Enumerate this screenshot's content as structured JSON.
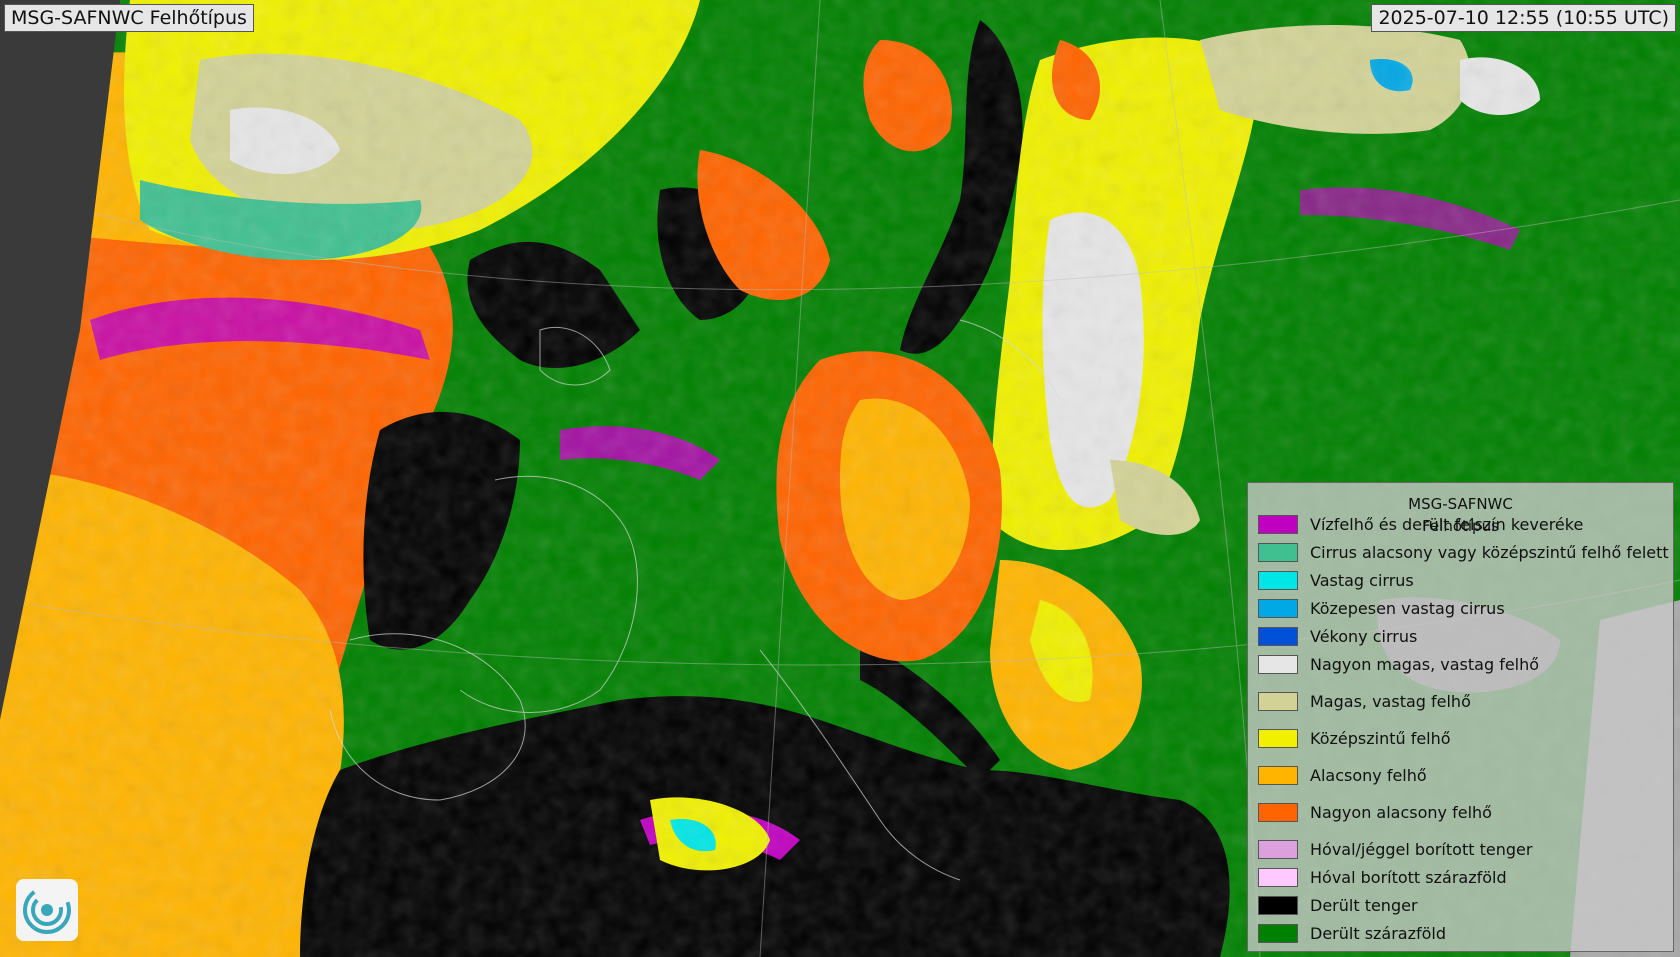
{
  "header": {
    "title": "MSG-SAFNWC Felhőtípus",
    "timestamp": "2025-07-10 12:55 (10:55 UTC)"
  },
  "legend": {
    "title_line1": "MSG-SAFNWC",
    "title_line2": "Felhőtípus",
    "items": [
      {
        "label": "Vízfelhő és derült felszín keveréke",
        "color": "#c000c0"
      },
      {
        "label": "Cirrus alacsony vagy középszintű felhő felett",
        "color": "#40c090"
      },
      {
        "label": "Vastag cirrus",
        "color": "#00e6e6"
      },
      {
        "label": "Közepesen vastag cirrus",
        "color": "#00a8e6"
      },
      {
        "label": "Vékony cirrus",
        "color": "#0050d8"
      },
      {
        "label": "Nagyon magas, vastag felhő",
        "color": "#e6e6e6"
      },
      {
        "label": "Magas, vastag felhő",
        "color": "#d2d296"
      },
      {
        "label": "Középszintű felhő",
        "color": "#f0f000"
      },
      {
        "label": "Alacsony felhő",
        "color": "#ffb400"
      },
      {
        "label": "Nagyon alacsony felhő",
        "color": "#ff6400"
      },
      {
        "label": "Hóval/jéggel borított tenger",
        "color": "#dca0dc"
      },
      {
        "label": "Hóval borított szárazföld",
        "color": "#ffc8ff"
      },
      {
        "label": "Derült tenger",
        "color": "#000000"
      },
      {
        "label": "Derült szárazföld",
        "color": "#008000"
      }
    ]
  },
  "logo": {
    "icon": "swirl-logo-icon",
    "color": "#3aa6b9"
  }
}
